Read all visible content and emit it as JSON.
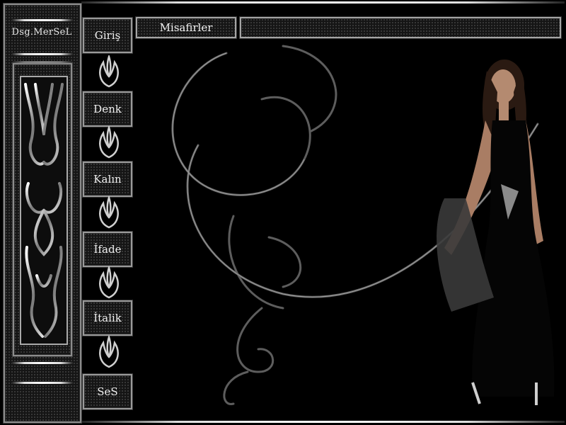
{
  "brand": {
    "title": "Dsg.MerSeL"
  },
  "nav": [
    {
      "label": "Giriş"
    },
    {
      "label": "Denk"
    },
    {
      "label": "Kalın"
    },
    {
      "label": "İfade"
    },
    {
      "label": "İtalik"
    },
    {
      "label": "SeS"
    }
  ],
  "header": {
    "guests_label": "Misafirler",
    "status_text": ""
  },
  "colors": {
    "background": "#000000",
    "metal": "#c8c8c8",
    "panel": "#151515"
  },
  "icons": {
    "ornament": "tribal-ornament-icon",
    "flower": "silver-flower-icon",
    "swirl": "swirl-decoration"
  }
}
